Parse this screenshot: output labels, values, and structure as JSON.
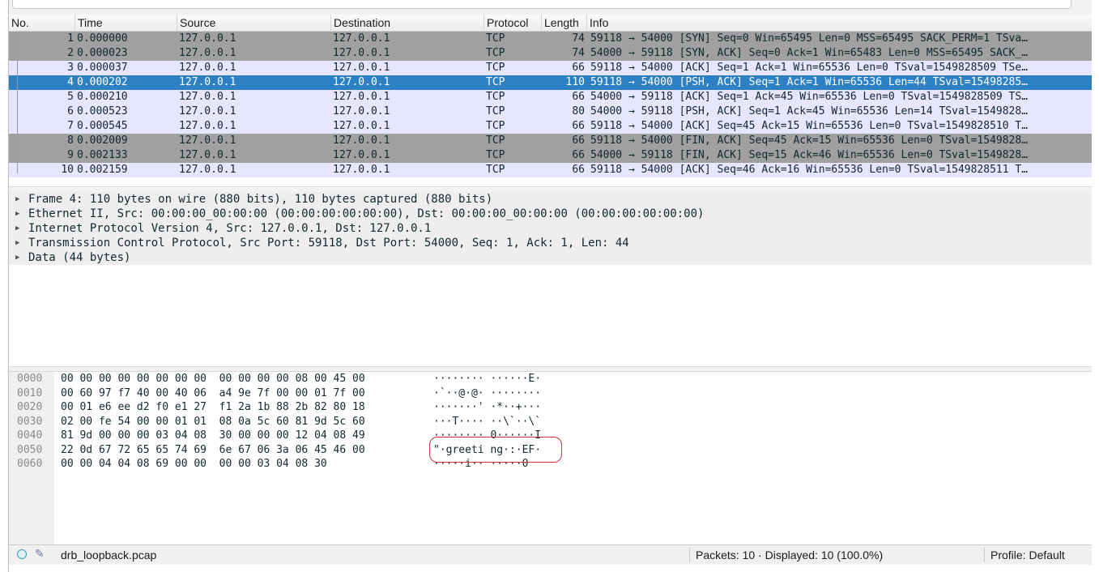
{
  "packet_list": {
    "columns": [
      "No.",
      "Time",
      "Source",
      "Destination",
      "Protocol",
      "Length",
      "Info"
    ],
    "rows": [
      {
        "no": "1",
        "time": "0.000000",
        "src": "127.0.0.1",
        "dst": "127.0.0.1",
        "proto": "TCP",
        "len": "74",
        "info": "59118 → 54000 [SYN] Seq=0 Win=65495 Len=0 MSS=65495 SACK_PERM=1 TSva…",
        "kind": "synfin"
      },
      {
        "no": "2",
        "time": "0.000023",
        "src": "127.0.0.1",
        "dst": "127.0.0.1",
        "proto": "TCP",
        "len": "74",
        "info": "54000 → 59118 [SYN, ACK] Seq=0 Ack=1 Win=65483 Len=0 MSS=65495 SACK_…",
        "kind": "synfin"
      },
      {
        "no": "3",
        "time": "0.000037",
        "src": "127.0.0.1",
        "dst": "127.0.0.1",
        "proto": "TCP",
        "len": "66",
        "info": "59118 → 54000 [ACK] Seq=1 Ack=1 Win=65536 Len=0 TSval=1549828509 TSe…",
        "kind": "tcp"
      },
      {
        "no": "4",
        "time": "0.000202",
        "src": "127.0.0.1",
        "dst": "127.0.0.1",
        "proto": "TCP",
        "len": "110",
        "info": "59118 → 54000 [PSH, ACK] Seq=1 Ack=1 Win=65536 Len=44 TSval=15498285…",
        "kind": "selected"
      },
      {
        "no": "5",
        "time": "0.000210",
        "src": "127.0.0.1",
        "dst": "127.0.0.1",
        "proto": "TCP",
        "len": "66",
        "info": "54000 → 59118 [ACK] Seq=1 Ack=45 Win=65536 Len=0 TSval=1549828509 TS…",
        "kind": "tcp"
      },
      {
        "no": "6",
        "time": "0.000523",
        "src": "127.0.0.1",
        "dst": "127.0.0.1",
        "proto": "TCP",
        "len": "80",
        "info": "54000 → 59118 [PSH, ACK] Seq=1 Ack=45 Win=65536 Len=14 TSval=1549828…",
        "kind": "tcp"
      },
      {
        "no": "7",
        "time": "0.000545",
        "src": "127.0.0.1",
        "dst": "127.0.0.1",
        "proto": "TCP",
        "len": "66",
        "info": "59118 → 54000 [ACK] Seq=45 Ack=15 Win=65536 Len=0 TSval=1549828510 T…",
        "kind": "tcp"
      },
      {
        "no": "8",
        "time": "0.002009",
        "src": "127.0.0.1",
        "dst": "127.0.0.1",
        "proto": "TCP",
        "len": "66",
        "info": "59118 → 54000 [FIN, ACK] Seq=45 Ack=15 Win=65536 Len=0 TSval=1549828…",
        "kind": "synfin"
      },
      {
        "no": "9",
        "time": "0.002133",
        "src": "127.0.0.1",
        "dst": "127.0.0.1",
        "proto": "TCP",
        "len": "66",
        "info": "54000 → 59118 [FIN, ACK] Seq=15 Ack=46 Win=65536 Len=0 TSval=1549828…",
        "kind": "synfin"
      },
      {
        "no": "10",
        "time": "0.002159",
        "src": "127.0.0.1",
        "dst": "127.0.0.1",
        "proto": "TCP",
        "len": "66",
        "info": "59118 → 54000 [ACK] Seq=46 Ack=16 Win=65536 Len=0 TSval=1549828511 T…",
        "kind": "tcp"
      }
    ]
  },
  "details": [
    "Frame 4: 110 bytes on wire (880 bits), 110 bytes captured (880 bits)",
    "Ethernet II, Src: 00:00:00_00:00:00 (00:00:00:00:00:00), Dst: 00:00:00_00:00:00 (00:00:00:00:00:00)",
    "Internet Protocol Version 4, Src: 127.0.0.1, Dst: 127.0.0.1",
    "Transmission Control Protocol, Src Port: 59118, Dst Port: 54000, Seq: 1, Ack: 1, Len: 44",
    "Data (44 bytes)"
  ],
  "hex": [
    {
      "off": "0000",
      "bytes": "00 00 00 00 00 00 00 00  00 00 00 00 08 00 45 00",
      "ascii": "········ ······E·"
    },
    {
      "off": "0010",
      "bytes": "00 60 97 f7 40 00 40 06  a4 9e 7f 00 00 01 7f 00",
      "ascii": "·`··@·@· ········"
    },
    {
      "off": "0020",
      "bytes": "00 01 e6 ee d2 f0 e1 27  f1 2a 1b 88 2b 82 80 18",
      "ascii": "·······' ·*··+···"
    },
    {
      "off": "0030",
      "bytes": "02 00 fe 54 00 00 01 01  08 0a 5c 60 81 9d 5c 60",
      "ascii": "···T···· ··\\`··\\`"
    },
    {
      "off": "0040",
      "bytes": "81 9d 00 00 00 03 04 08  30 00 00 00 12 04 08 49",
      "ascii": "········ 0······I"
    },
    {
      "off": "0050",
      "bytes": "22 0d 67 72 65 65 74 69  6e 67 06 3a 06 45 46 00",
      "ascii": "\"·greeti ng·:·EF·"
    },
    {
      "off": "0060",
      "bytes": "00 00 04 04 08 69 00 00  00 00 03 04 08 30",
      "ascii": "·····i·· ·····0"
    }
  ],
  "status": {
    "file": "drb_loopback.pcap",
    "packets": "Packets: 10 · Displayed: 10 (100.0%)",
    "profile": "Profile: Default"
  },
  "colors": {
    "selected": "#2c80c3",
    "tcp": "#e7e6ff",
    "synfin": "#a0a0a0",
    "annotation": "#d0333c"
  },
  "icons": [
    "capture-status-icon",
    "edit-comment-icon",
    "expand-triangle-icon"
  ]
}
